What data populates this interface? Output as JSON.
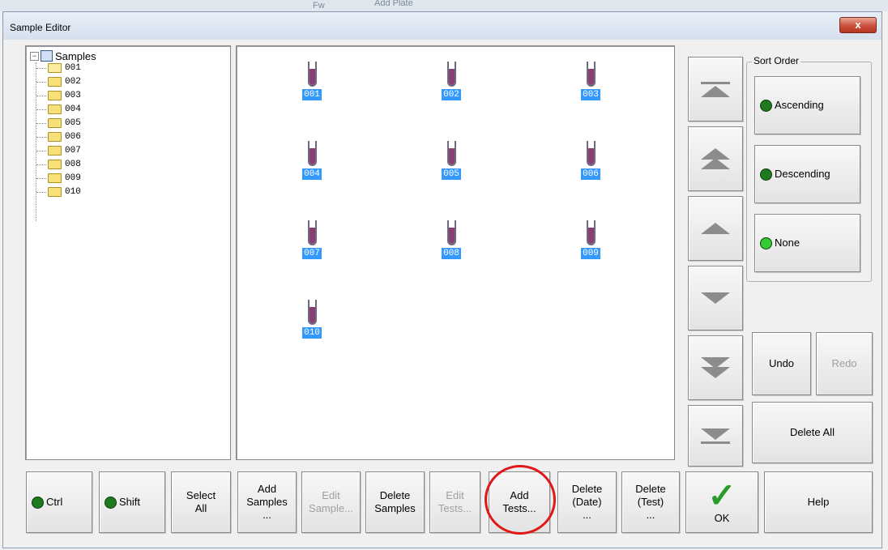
{
  "background": {
    "ghost_text": "Add Plate",
    "ghost_text2": "Fw"
  },
  "window": {
    "title": "Sample Editor",
    "close_label": "x"
  },
  "tree": {
    "root": "Samples",
    "expander": "−",
    "items": [
      "001",
      "002",
      "003",
      "004",
      "005",
      "006",
      "007",
      "008",
      "009",
      "010"
    ]
  },
  "samples": [
    "001",
    "002",
    "003",
    "004",
    "005",
    "006",
    "007",
    "008",
    "009",
    "010"
  ],
  "sort_order": {
    "legend": "Sort Order",
    "options": [
      "Ascending",
      "Descending",
      "None"
    ]
  },
  "right_buttons": {
    "undo": "Undo",
    "redo": "Redo",
    "delete_all": "Delete All"
  },
  "bottom_buttons": {
    "ctrl": "Ctrl",
    "shift": "Shift",
    "select_all_l1": "Select",
    "select_all_l2": "All",
    "add_samples_l1": "Add",
    "add_samples_l2": "Samples",
    "add_samples_l3": "...",
    "edit_sample_l1": "Edit",
    "edit_sample_l2": "Sample...",
    "delete_samples_l1": "Delete",
    "delete_samples_l2": "Samples",
    "edit_tests_l1": "Edit",
    "edit_tests_l2": "Tests...",
    "add_tests_l1": "Add",
    "add_tests_l2": "Tests...",
    "delete_date_l1": "Delete",
    "delete_date_l2": "(Date)",
    "delete_date_l3": "...",
    "delete_test_l1": "Delete",
    "delete_test_l2": "(Test)",
    "delete_test_l3": "...",
    "ok": "OK",
    "help": "Help"
  },
  "colors": {
    "selection": "#3399ff",
    "led_dark": "#1f7a1f",
    "led_bright": "#33cc33",
    "highlight_circle": "#e01818",
    "tube_fill": "#8a3e74"
  }
}
